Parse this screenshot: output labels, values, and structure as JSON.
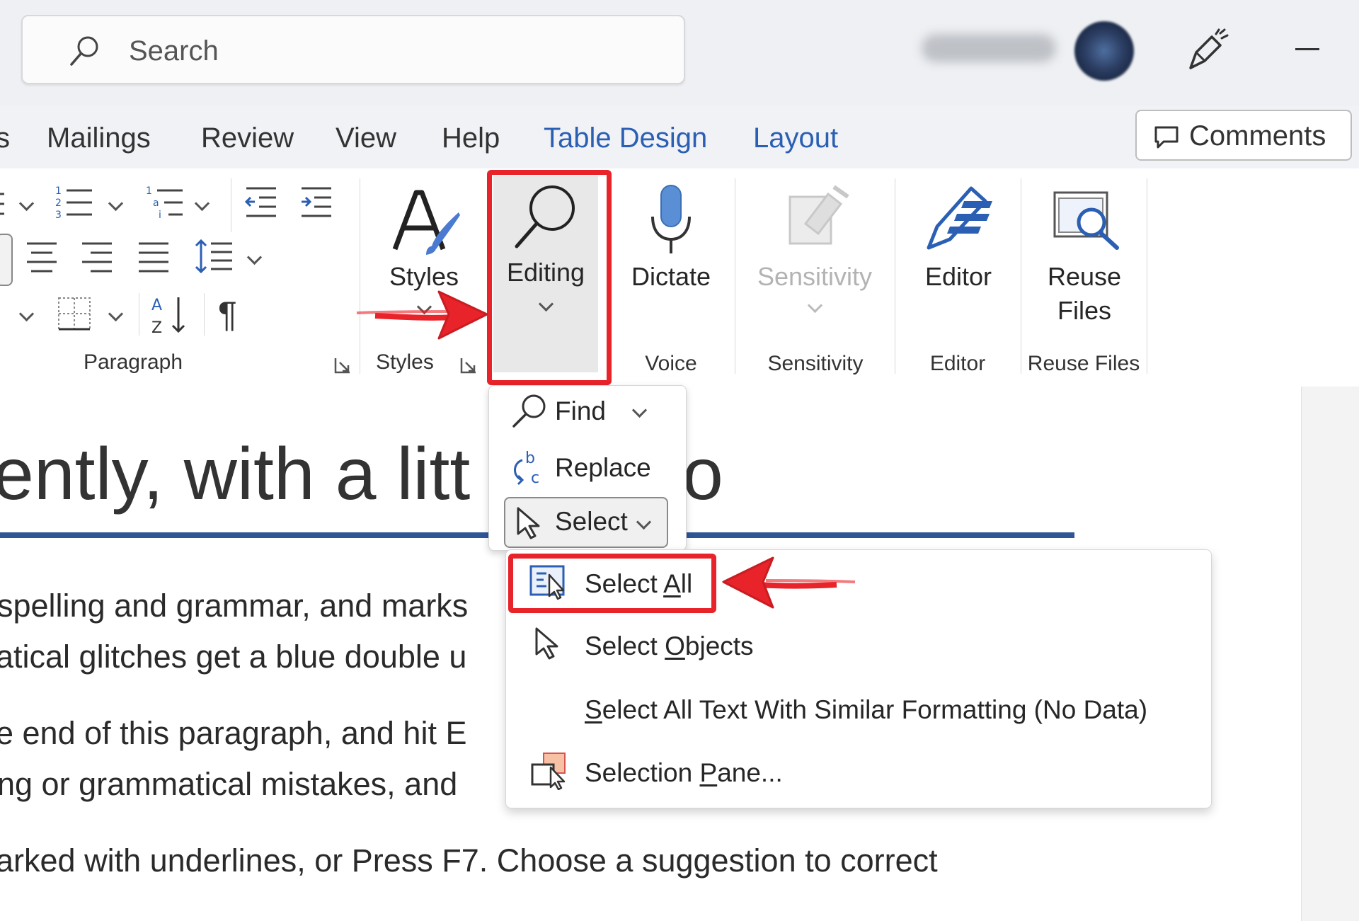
{
  "titlebar": {
    "search_placeholder": "Search"
  },
  "tabs": [
    {
      "label": "s"
    },
    {
      "label": "Mailings"
    },
    {
      "label": "Review"
    },
    {
      "label": "View"
    },
    {
      "label": "Help"
    },
    {
      "label": "Table Design"
    },
    {
      "label": "Layout"
    }
  ],
  "comments_label": "Comments",
  "ribbon": {
    "paragraph_group": "Paragraph",
    "styles_button": "Styles",
    "styles_group": "Styles",
    "editing_button": "Editing",
    "dictate_button": "Dictate",
    "voice_group": "Voice",
    "sensitivity_button": "Sensitivity",
    "sensitivity_group": "Sensitivity",
    "editor_button": "Editor",
    "editor_group": "Editor",
    "reuse_button_line1": "Reuse",
    "reuse_button_line2": "Files",
    "reuse_group": "Reuse Files"
  },
  "document": {
    "heading": "ently, with a litt",
    "heading_tail": "o",
    "lines": [
      "spelling and grammar, and marks",
      "atical glitches get a blue double u",
      "e end of this paragraph, and hit E",
      "ng or grammatical mistakes, and",
      "arked with underlines, or Press F7. Choose a suggestion to correct"
    ]
  },
  "editing_menu": {
    "find": "Find",
    "replace": "Replace",
    "select": "Select"
  },
  "select_menu": {
    "select_all_pre": "Select ",
    "select_all_u": "A",
    "select_all_post": "ll",
    "select_objects_pre": "Select ",
    "select_objects_u": "O",
    "select_objects_post": "bjects",
    "similar_u": "S",
    "similar_post": "elect All Text With Similar Formatting (No Data)",
    "pane_pre": "Selection ",
    "pane_u": "P",
    "pane_post": "ane..."
  },
  "colors": {
    "highlight": "#e8232a",
    "contextual_tab": "#2b5fb3",
    "heading_rule": "#2f5597"
  }
}
